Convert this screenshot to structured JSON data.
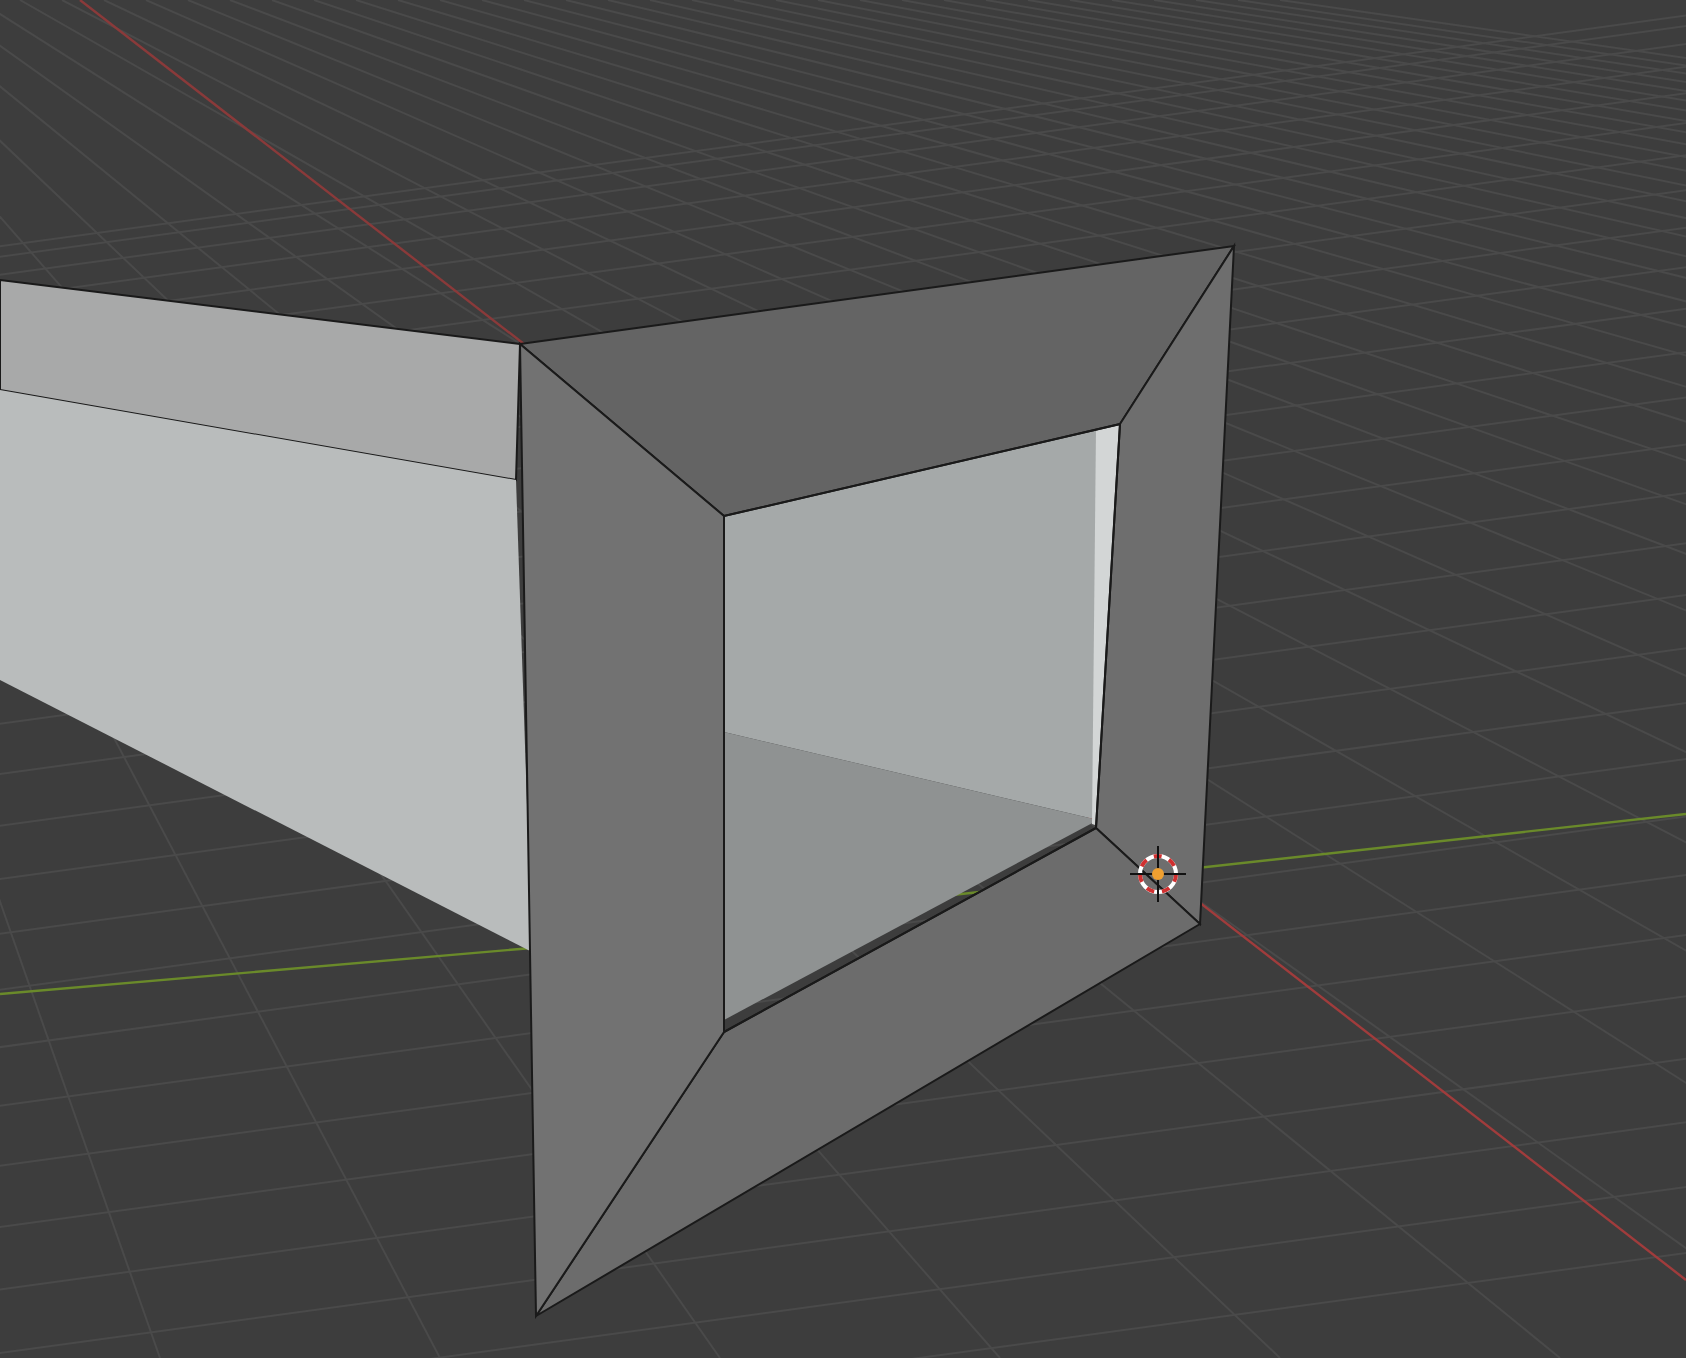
{
  "viewport": {
    "grid": true,
    "axes": true,
    "cursor_3d": true
  }
}
